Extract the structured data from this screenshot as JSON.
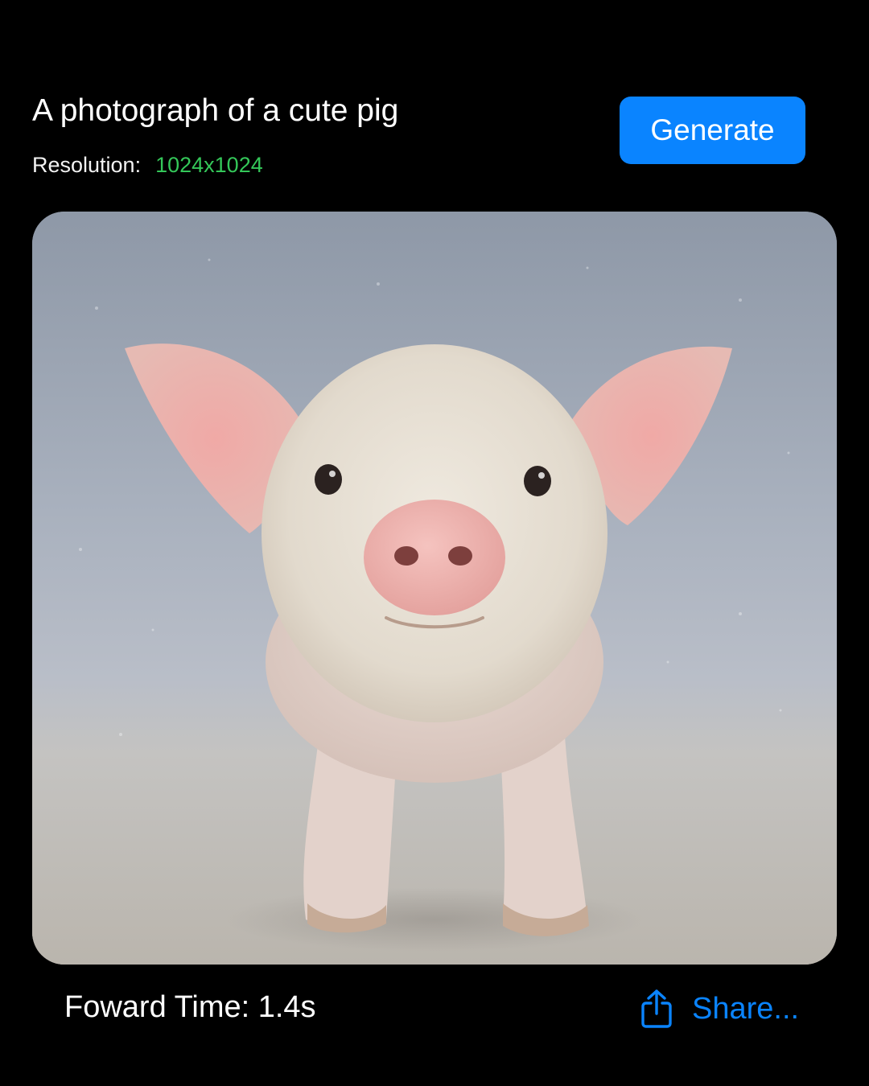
{
  "header": {
    "prompt": "A photograph of a cute pig",
    "resolution_label": "Resolution:",
    "resolution_value": "1024x1024",
    "generate_label": "Generate"
  },
  "image": {
    "subject": "pig-photo"
  },
  "footer": {
    "forward_time": "Foward Time: 1.4s",
    "share_label": "Share...",
    "share_icon": "share-icon"
  },
  "colors": {
    "background": "#000000",
    "accent": "#0a84ff",
    "resolution_value": "#34c759",
    "text": "#ffffff"
  }
}
